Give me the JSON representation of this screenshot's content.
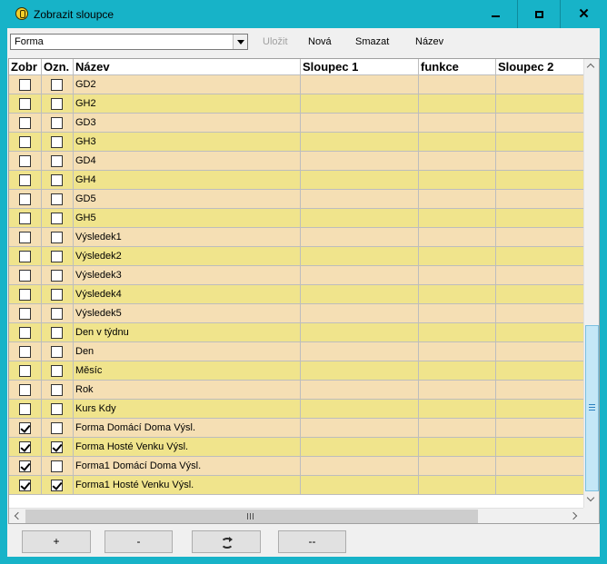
{
  "window": {
    "title": "Zobrazit sloupce",
    "minimize_icon": "minimize-icon",
    "maximize_icon": "maximize-icon",
    "close_icon": "close-icon"
  },
  "toolbar": {
    "combo_value": "Forma",
    "save_label": "Uložit",
    "new_label": "Nová",
    "delete_label": "Smazat",
    "name_label": "Název"
  },
  "grid": {
    "columns": [
      "Zobr",
      "Ozn.",
      "Název",
      "Sloupec 1",
      "funkce",
      "Sloupec 2"
    ],
    "rows": [
      {
        "show": false,
        "mark": false,
        "name": "GD2",
        "color": "#f5dfb4"
      },
      {
        "show": false,
        "mark": false,
        "name": "GH2",
        "color": "#f0e48c"
      },
      {
        "show": false,
        "mark": false,
        "name": "GD3",
        "color": "#f5dfb4"
      },
      {
        "show": false,
        "mark": false,
        "name": "GH3",
        "color": "#f0e48c"
      },
      {
        "show": false,
        "mark": false,
        "name": "GD4",
        "color": "#f5dfb4"
      },
      {
        "show": false,
        "mark": false,
        "name": "GH4",
        "color": "#f0e48c"
      },
      {
        "show": false,
        "mark": false,
        "name": "GD5",
        "color": "#f5dfb4"
      },
      {
        "show": false,
        "mark": false,
        "name": "GH5",
        "color": "#f0e48c"
      },
      {
        "show": false,
        "mark": false,
        "name": "Výsledek1",
        "color": "#f5dfb4"
      },
      {
        "show": false,
        "mark": false,
        "name": "Výsledek2",
        "color": "#f0e48c"
      },
      {
        "show": false,
        "mark": false,
        "name": "Výsledek3",
        "color": "#f5dfb4"
      },
      {
        "show": false,
        "mark": false,
        "name": "Výsledek4",
        "color": "#f0e48c"
      },
      {
        "show": false,
        "mark": false,
        "name": "Výsledek5",
        "color": "#f5dfb4"
      },
      {
        "show": false,
        "mark": false,
        "name": "Den v týdnu",
        "color": "#f0e48c"
      },
      {
        "show": false,
        "mark": false,
        "name": "Den",
        "color": "#f5dfb4"
      },
      {
        "show": false,
        "mark": false,
        "name": "Měsíc",
        "color": "#f0e48c"
      },
      {
        "show": false,
        "mark": false,
        "name": "Rok",
        "color": "#f5dfb4"
      },
      {
        "show": false,
        "mark": false,
        "name": "Kurs Kdy",
        "color": "#f0e48c"
      },
      {
        "show": true,
        "mark": false,
        "name": "Forma Domácí Doma Výsl.",
        "color": "#f5dfb4"
      },
      {
        "show": true,
        "mark": true,
        "name": "Forma Hosté Venku Výsl.",
        "color": "#f0e48c"
      },
      {
        "show": true,
        "mark": false,
        "name": "Forma1 Domácí Doma Výsl.",
        "color": "#f5dfb4"
      },
      {
        "show": true,
        "mark": true,
        "name": "Forma1 Hosté Venku Výsl.",
        "color": "#f0e48c"
      }
    ]
  },
  "bottom": {
    "add_label": "+",
    "remove_label": "-",
    "refresh_icon": "refresh-icon",
    "clear_label": "--"
  }
}
